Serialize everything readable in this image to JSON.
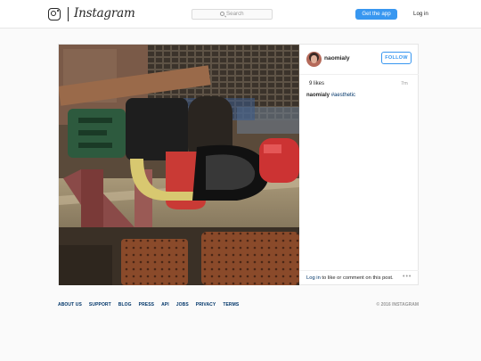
{
  "header": {
    "logo_text": "Instagram",
    "search_placeholder": "Search",
    "get_app_label": "Get the app",
    "login_label": "Log in"
  },
  "post": {
    "username": "naomialy",
    "follow_label": "FOLLOW",
    "likes": "9 likes",
    "time": "7m",
    "caption": {
      "username": "naomialy",
      "hashtag": "#aesthetic"
    },
    "comment_prompt": {
      "login_link": "Log in",
      "text": "to like or comment on this post."
    },
    "more_icon": "ellipsis-icon"
  },
  "footer": {
    "links": [
      "ABOUT US",
      "SUPPORT",
      "BLOG",
      "PRESS",
      "API",
      "JOBS",
      "PRIVACY",
      "TERMS"
    ],
    "copyright": "© 2016 INSTAGRAM"
  },
  "colors": {
    "accent": "#3897f0",
    "link": "#003569",
    "background": "#fafafa"
  }
}
